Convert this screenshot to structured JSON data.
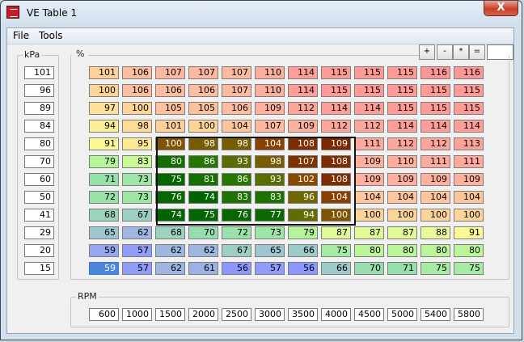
{
  "window": {
    "title": "VE Table 1",
    "close_label": "X"
  },
  "menu": [
    "File",
    "Tools"
  ],
  "toolbar": {
    "buttons": [
      "+",
      "-",
      "*",
      "="
    ],
    "value": ""
  },
  "kpa_label": "kPa",
  "percent_label": "%",
  "rpm_label": "RPM",
  "kpa": [
    "101",
    "96",
    "89",
    "84",
    "80",
    "70",
    "60",
    "50",
    "41",
    "29",
    "20",
    "15"
  ],
  "rpm": [
    "600",
    "1000",
    "1500",
    "2000",
    "2500",
    "3000",
    "3500",
    "4000",
    "4500",
    "5000",
    "5400",
    "5800"
  ],
  "ve": [
    [
      "101",
      "106",
      "107",
      "107",
      "107",
      "110",
      "114",
      "115",
      "115",
      "115",
      "116",
      "116"
    ],
    [
      "100",
      "106",
      "106",
      "106",
      "107",
      "110",
      "114",
      "115",
      "115",
      "115",
      "115",
      "115"
    ],
    [
      "97",
      "100",
      "105",
      "105",
      "106",
      "109",
      "112",
      "114",
      "114",
      "115",
      "115",
      "115"
    ],
    [
      "94",
      "98",
      "101",
      "100",
      "104",
      "107",
      "109",
      "112",
      "112",
      "114",
      "114",
      "114"
    ],
    [
      "91",
      "95",
      "100",
      "98",
      "98",
      "104",
      "108",
      "109",
      "111",
      "112",
      "112",
      "113"
    ],
    [
      "79",
      "83",
      "80",
      "86",
      "93",
      "98",
      "107",
      "108",
      "109",
      "110",
      "111",
      "111"
    ],
    [
      "71",
      "73",
      "75",
      "81",
      "86",
      "93",
      "102",
      "108",
      "109",
      "109",
      "109",
      "109"
    ],
    [
      "72",
      "73",
      "76",
      "74",
      "83",
      "83",
      "96",
      "104",
      "104",
      "104",
      "104",
      "104"
    ],
    [
      "68",
      "67",
      "74",
      "75",
      "76",
      "77",
      "94",
      "100",
      "100",
      "100",
      "100",
      "100"
    ],
    [
      "65",
      "62",
      "68",
      "70",
      "72",
      "73",
      "79",
      "87",
      "87",
      "87",
      "88",
      "91"
    ],
    [
      "59",
      "57",
      "62",
      "62",
      "67",
      "65",
      "66",
      "75",
      "80",
      "80",
      "80",
      "80"
    ],
    [
      "59",
      "57",
      "62",
      "61",
      "56",
      "57",
      "56",
      "66",
      "70",
      "71",
      "75",
      "75"
    ]
  ],
  "colors": {
    "titlebar_close": "#c7402a",
    "selection_border": "#111111"
  }
}
